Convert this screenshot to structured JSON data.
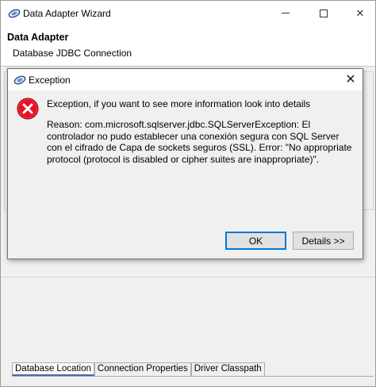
{
  "wizard": {
    "title": "Data Adapter Wizard",
    "heading": "Data Adapter",
    "subheading": "Database JDBC Connection",
    "tabs": [
      {
        "label": "Database Location"
      },
      {
        "label": "Connection Properties"
      },
      {
        "label": "Driver Classpath"
      }
    ]
  },
  "dialog": {
    "title": "Exception",
    "message": "Exception, if you want to see more information look into details",
    "reason": "Reason: com.microsoft.sqlserver.jdbc.SQLServerException: El controlador no pudo establecer una conexión segura con SQL Server con el cifrado de Capa de sockets seguros (SSL). Error: \"No appropriate protocol (protocol is disabled or cipher suites are inappropriate)\".",
    "ok_label": "OK",
    "details_label": "Details >>"
  },
  "colors": {
    "error_red": "#e81123",
    "focus_blue": "#0078d7"
  },
  "icons": {
    "app": "eclipse-logo-icon",
    "error": "error-icon"
  }
}
